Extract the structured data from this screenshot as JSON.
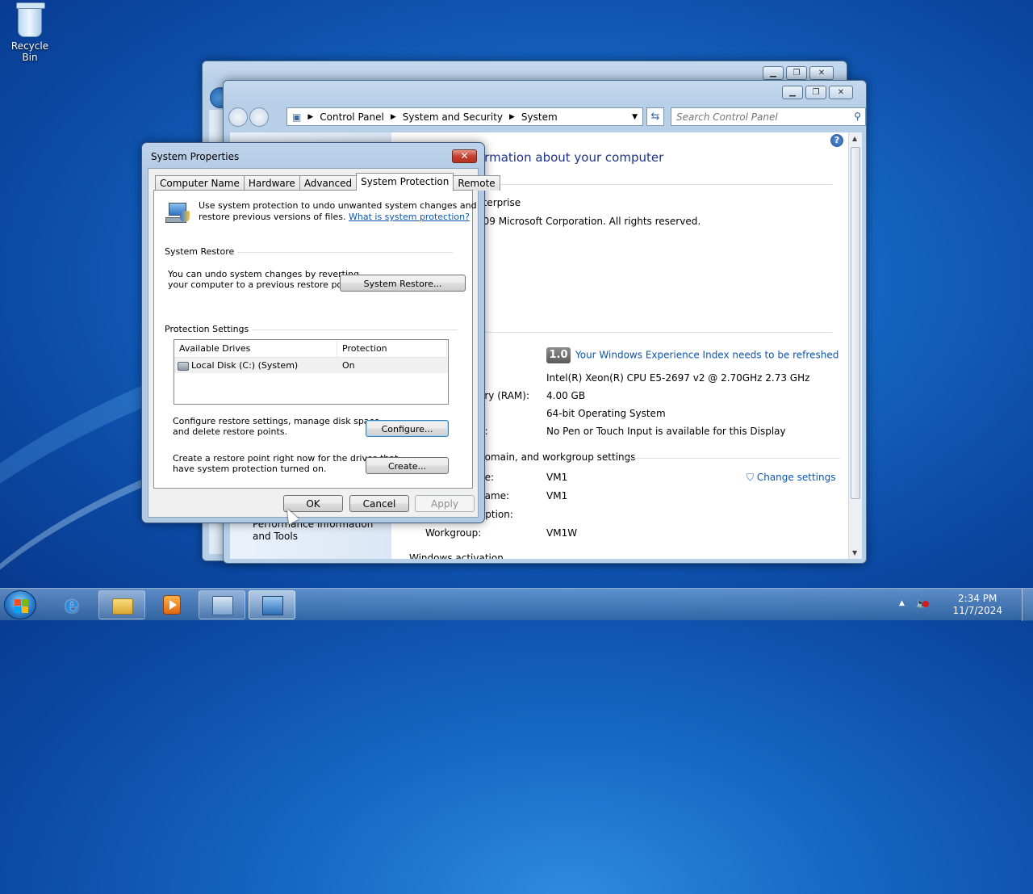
{
  "desktop": {
    "recycle_bin_label": "Recycle Bin"
  },
  "control_panel": {
    "breadcrumb": [
      "Control Panel",
      "System and Security",
      "System"
    ],
    "search_placeholder": "Search Control Panel",
    "heading": "ormation about your computer",
    "edition_line": "nterprise",
    "copyright": "009 Microsoft Corporation.  All rights reserved.",
    "left_pane_link": "Performance Information and Tools",
    "system": {
      "rating_value": "1.0",
      "rating_link": "Your Windows Experience Index needs to be refreshed",
      "processor": "Intel(R) Xeon(R) CPU E5-2697 v2 @ 2.70GHz   2.73 GHz",
      "memory_label": "ory (RAM):",
      "memory_value": "4.00 GB",
      "system_type": "64-bit Operating System",
      "pen_label": "n:",
      "pen_value": "No Pen or Touch Input is available for this Display"
    },
    "computer_section": {
      "title": "domain, and workgroup settings",
      "name_label": "ne:",
      "name_value": "VM1",
      "full_name_label": " name:",
      "full_name_value": "VM1",
      "description_label": "ription:",
      "workgroup_label": "Workgroup:",
      "workgroup_value": "VM1W",
      "change_settings": "Change settings",
      "next_section_partial": "Windows activation"
    }
  },
  "dialog": {
    "title": "System Properties",
    "tabs": [
      "Computer Name",
      "Hardware",
      "Advanced",
      "System Protection",
      "Remote"
    ],
    "active_tab": "System Protection",
    "intro_text_1": "Use system protection to undo unwanted system changes and",
    "intro_text_2": "restore previous versions of files.",
    "intro_link": "What is system protection?",
    "system_restore_group": "System Restore",
    "system_restore_text_1": "You can undo system changes by reverting",
    "system_restore_text_2": "your computer to a previous restore point.",
    "system_restore_button": "System Restore...",
    "protection_group": "Protection Settings",
    "columns": [
      "Available Drives",
      "Protection"
    ],
    "drives": [
      {
        "name": "Local Disk (C:) (System)",
        "protection": "On"
      }
    ],
    "configure_text_1": "Configure restore settings, manage disk space,",
    "configure_text_2": "and delete restore points.",
    "configure_button": "Configure...",
    "create_text_1": "Create a restore point right now for the drives that",
    "create_text_2": "have system protection turned on.",
    "create_button": "Create...",
    "ok_button": "OK",
    "cancel_button": "Cancel",
    "apply_button": "Apply"
  },
  "taskbar": {
    "time": "2:34 PM",
    "date": "11/7/2024",
    "items": [
      "internet-explorer",
      "windows-explorer",
      "windows-media-player",
      "control-panel",
      "system-properties"
    ]
  },
  "colors": {
    "link": "#0b55b0",
    "heading": "#1e3287",
    "close_red": "#c8412f"
  }
}
